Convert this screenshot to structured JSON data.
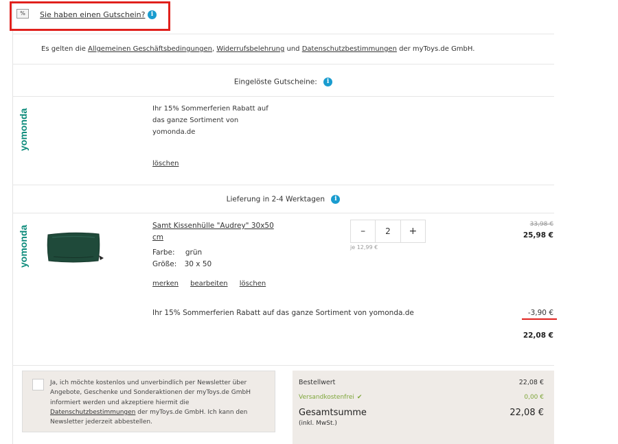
{
  "voucher": {
    "icon": "percent-voucher-icon",
    "link_label": "Sie haben einen Gutschein?",
    "info": "i"
  },
  "terms": {
    "prefix": "Es gelten die ",
    "agb": "Allgemeinen Geschäftsbedingungen",
    "sep1": ", ",
    "widerruf": "Widerrufsbelehrung",
    "sep2": " und ",
    "datenschutz": "Datenschutzbestimmungen",
    "suffix": " der myToys.de GmbH."
  },
  "redeemed": {
    "title": "Eingelöste Gutscheine:",
    "info": "i",
    "brand": "yomonda",
    "promo_lines": [
      "Ihr 15% Sommerferien Rabatt auf",
      "das ganze Sortiment von",
      "yomonda.de"
    ],
    "delete_label": "löschen"
  },
  "delivery": {
    "title": "Lieferung in 2-4 Werktagen",
    "info": "i"
  },
  "product": {
    "brand": "yomonda",
    "name": "Samt Kissenhülle \"Audrey\" 30x50 cm",
    "color_label": "Farbe:",
    "color_value": "grün",
    "size_label": "Größe:",
    "size_value": "30 x 50",
    "action_remember": "merken",
    "action_edit": "bearbeiten",
    "action_delete": "löschen",
    "qty_minus": "–",
    "qty_value": "2",
    "qty_plus": "+",
    "unit_price": "je 12,99 €",
    "price_old": "33,98 €",
    "price_new": "25,98 €",
    "discount_text": "Ihr 15% Sommerferien Rabatt auf das ganze Sortiment von yomonda.de",
    "discount_amount": "-3,90 €",
    "subtotal": "22,08 €"
  },
  "newsletter": {
    "text_before": "Ja, ich möchte kostenlos und unverbindlich per Newsletter über Angebote, Geschenke und Sonderaktionen der myToys.de GmbH informiert werden und akzeptiere hiermit die ",
    "link": "Datenschutzbestimmungen",
    "text_after": " der myToys.de GmbH. Ich kann den Newsletter jederzeit abbestellen."
  },
  "summary": {
    "order_value_label": "Bestellwert",
    "order_value": "22,08 €",
    "shipping_label": "Versandkostenfrei",
    "shipping_value": "0,00 €",
    "total_label": "Gesamtsumme",
    "total_value": "22,08 €",
    "vat_note": "(inkl. MwSt.)"
  },
  "colors": {
    "accent_red": "#e0201c",
    "info_blue": "#1a9ccf",
    "brand_teal": "#0b8a7a",
    "shipping_green": "#7ea63a"
  }
}
